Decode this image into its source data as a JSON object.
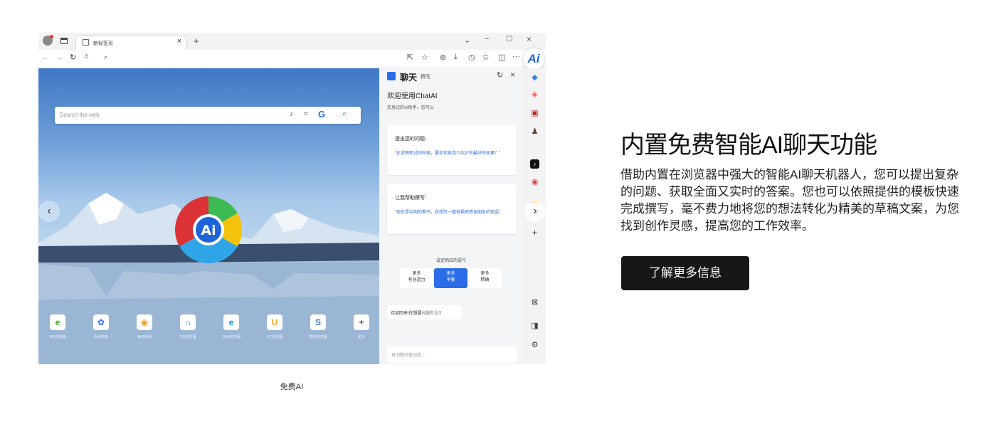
{
  "browser": {
    "tab_title": "新标签页",
    "search_placeholder": "Search the web",
    "shortcuts": [
      {
        "label": "360浏览器",
        "color": "#3fae29",
        "glyph": "e"
      },
      {
        "label": "百度搜索",
        "color": "#2f6bf0",
        "glyph": "✿"
      },
      {
        "label": "每日新闻",
        "color": "#f29b1a",
        "glyph": "◉"
      },
      {
        "label": "QQ浏览器",
        "color": "#1e88e5",
        "glyph": "∩"
      },
      {
        "label": "2345浏览器",
        "color": "#2196f3",
        "glyph": "e"
      },
      {
        "label": "UC浏览器",
        "color": "#f5a623",
        "glyph": "U"
      },
      {
        "label": "搜狗浏览器",
        "color": "#3a7be0",
        "glyph": "S"
      },
      {
        "label": "更多",
        "color": "#ffffff",
        "glyph": "+"
      }
    ]
  },
  "chat": {
    "tab_chat": "聊天",
    "tab_write": "撰写",
    "welcome_title": "欢迎使用ChatAI",
    "welcome_sub": "您身边的AI助手，您可以",
    "card1_title": "提出您的问题:",
    "card1_body": "“在求职面试的时候，要如何自我介绍才有最好的效果？”",
    "card2_title": "让我帮助撰写:",
    "card2_body": "“现在是中国的春节，我想写一篇祝福来感谢朋友的短语”",
    "tone_title": "设定响应的语气",
    "tone_options": [
      {
        "line1": "更多",
        "line2": "有创造力"
      },
      {
        "line1": "更多",
        "line2": "平衡"
      },
      {
        "line1": "更多",
        "line2": "精确"
      }
    ],
    "greeting": "欢迎回来!你想要讨论什么?",
    "input_placeholder": "有问题尽管问我..."
  },
  "caption": "免费AI",
  "hero": {
    "title": "内置免费智能AI聊天功能",
    "body": "借助内置在浏览器中强大的智能AI聊天机器人，您可以提出复杂的问题、获取全面又实时的答案。您也可以依照提供的模板快速完成撰写，毫不费力地将您的想法转化为精美的草稿文案，为您找到创作灵感，提高您的工作效率。",
    "button": "了解更多信息"
  }
}
